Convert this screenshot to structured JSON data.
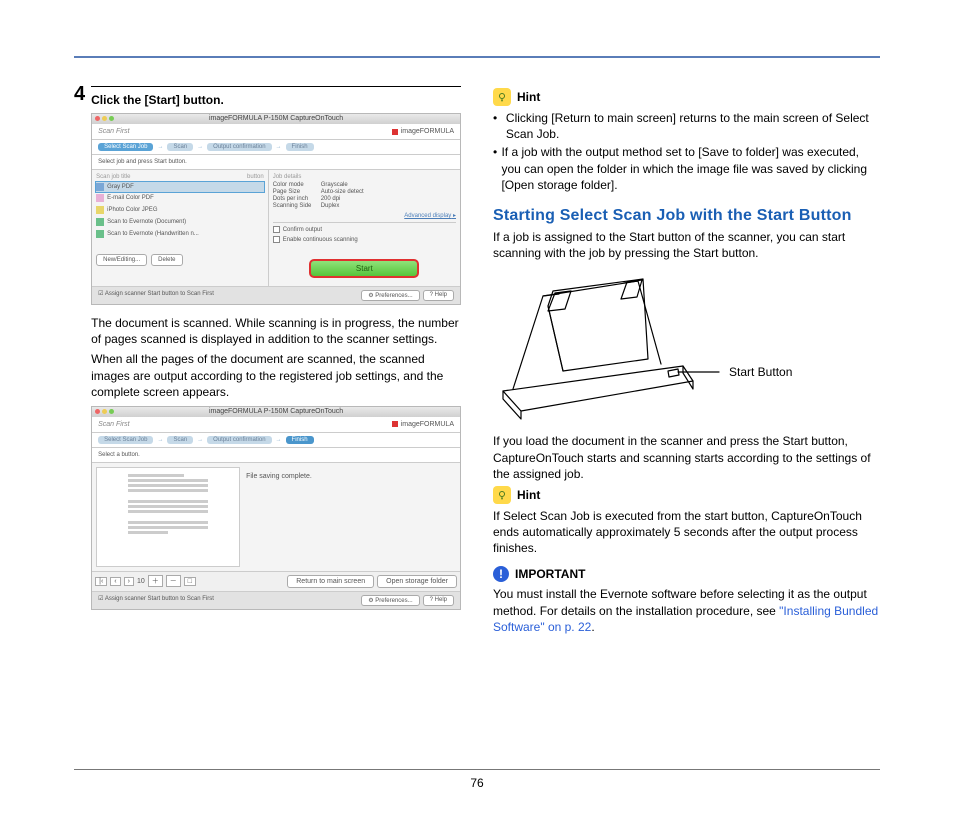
{
  "page_number": "76",
  "left": {
    "step_number": "4",
    "step_title": "Click the [Start] button.",
    "para1": "The document is scanned. While scanning is in progress, the number of pages scanned is displayed in addition to the scanner settings.",
    "para2": "When all the pages of the document are scanned, the scanned images are output according to the registered job settings, and the complete screen appears."
  },
  "screenshot1": {
    "title": "imageFORMULA P-150M CaptureOnTouch",
    "app_name": "Scan First",
    "brand": "imageFORMULA",
    "steps": [
      "Select Scan Job",
      "Scan",
      "Output confirmation",
      "Finish"
    ],
    "select_bar": "Select job and press Start button.",
    "joblist_header": {
      "name": "Scan job title",
      "button": "button"
    },
    "jobs": [
      "Gray PDF",
      "E-mail Color PDF",
      "iPhoto Color JPEG",
      "Scan to Evernote (Document)",
      "Scan to Evernote (Handwritten n..."
    ],
    "details_title": "Job details",
    "details": {
      "Color mode": "Grayscale",
      "Page Size": "Auto-size detect",
      "Dots per inch": "200 dpi",
      "Scanning Side": "Duplex"
    },
    "advanced": "Advanced display",
    "checkbox1": "Confirm output",
    "checkbox2": "Enable continuous scanning",
    "btn_new": "New/Editing...",
    "btn_delete": "Delete",
    "start": "Start",
    "footer_assign": "Assign scanner Start button to Scan First",
    "footer_prefs": "Preferences...",
    "footer_help": "Help"
  },
  "screenshot2": {
    "title": "imageFORMULA P-150M CaptureOnTouch",
    "app_name": "Scan First",
    "brand": "imageFORMULA",
    "steps": [
      "Select Scan Job",
      "Scan",
      "Output confirmation",
      "Finish"
    ],
    "select_bar": "Select a button.",
    "message": "File saving complete.",
    "page_counter": "10",
    "btn_return": "Return to main screen",
    "btn_open": "Open storage folder",
    "footer_assign": "Assign scanner Start button to Scan First",
    "footer_prefs": "Preferences...",
    "footer_help": "Help"
  },
  "right": {
    "hint_label": "Hint",
    "hint_bullet1": "Clicking [Return to main screen] returns to the main screen of Select Scan Job.",
    "hint_bullet2": "If a job with the output method set to [Save to folder] was executed, you can open the folder in which the image file was saved by clicking [Open storage folder].",
    "heading": "Starting Select Scan Job with the Start Button",
    "para_after_heading": "If a job is assigned to the Start button of the scanner, you can start scanning with the job by pressing the Start button.",
    "start_button_label": "Start Button",
    "para_after_fig": "If you load the document in the scanner and press the Start button, CaptureOnTouch starts and scanning starts according to the settings of the assigned job.",
    "hint2": "If Select Scan Job is executed from the start button, CaptureOnTouch ends automatically approximately 5 seconds after the output process finishes.",
    "important_label": "IMPORTANT",
    "important_text": "You must install the Evernote software before selecting it as the output method. For details on the installation procedure, see ",
    "important_link": "\"Installing Bundled Software\" on p. 22",
    "important_tail": "."
  }
}
